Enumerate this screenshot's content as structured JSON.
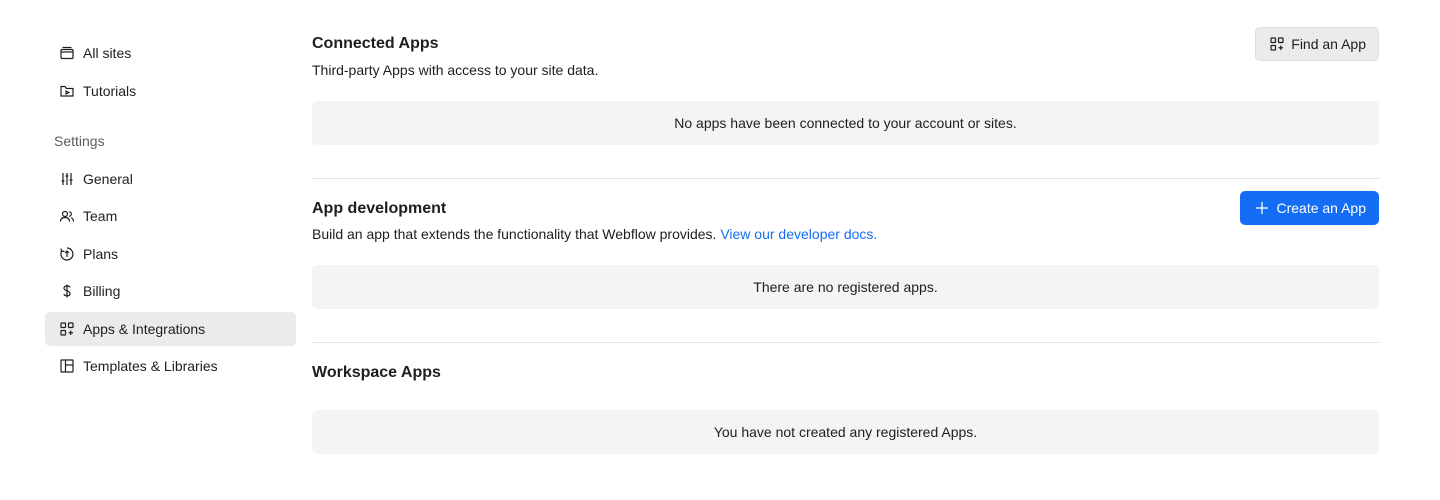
{
  "sidebar": {
    "items_top": [
      {
        "label": "All sites",
        "icon": "sites-icon"
      },
      {
        "label": "Tutorials",
        "icon": "tutorials-icon"
      }
    ],
    "settings_heading": "Settings",
    "items_settings": [
      {
        "label": "General",
        "icon": "sliders-icon"
      },
      {
        "label": "Team",
        "icon": "team-icon"
      },
      {
        "label": "Plans",
        "icon": "plans-icon"
      },
      {
        "label": "Billing",
        "icon": "dollar-icon"
      },
      {
        "label": "Apps & Integrations",
        "icon": "apps-icon",
        "active": true
      },
      {
        "label": "Templates & Libraries",
        "icon": "templates-icon"
      }
    ]
  },
  "connected_apps": {
    "title": "Connected Apps",
    "description": "Third-party Apps with access to your site data.",
    "button_label": "Find an App",
    "empty_message": "No apps have been connected to your account or sites."
  },
  "app_development": {
    "title": "App development",
    "description": "Build an app that extends the functionality that Webflow provides.",
    "link_label": "View our developer docs.",
    "button_label": "Create an App",
    "empty_message": "There are no registered apps."
  },
  "workspace_apps": {
    "title": "Workspace Apps",
    "empty_message": "You have not created any registered Apps."
  },
  "colors": {
    "accent": "#146ef5",
    "active_bg": "#ebebeb",
    "empty_bg": "#f4f4f4"
  }
}
